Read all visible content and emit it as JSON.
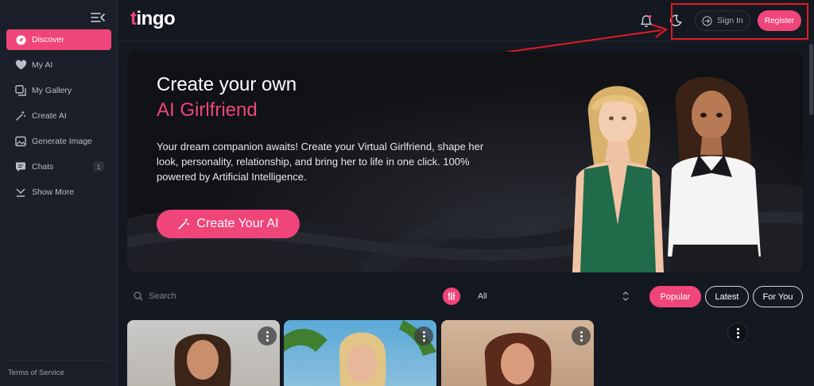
{
  "app": {
    "logo_text": "ingo",
    "logo_initial": "t"
  },
  "sidebar": {
    "items": [
      {
        "label": "Discover",
        "icon": "compass-icon",
        "active": true
      },
      {
        "label": "My AI",
        "icon": "heart-icon"
      },
      {
        "label": "My Gallery",
        "icon": "gallery-icon"
      },
      {
        "label": "Create AI",
        "icon": "magic-wand-icon"
      },
      {
        "label": "Generate Image",
        "icon": "image-icon"
      },
      {
        "label": "Chats",
        "icon": "chat-icon",
        "badge": "1"
      },
      {
        "label": "Show More",
        "icon": "chevron-down-icon"
      }
    ],
    "footer_link": "Terms of Service"
  },
  "header": {
    "signin_label": "Sign In",
    "register_label": "Register"
  },
  "hero": {
    "title_line1": "Create your own",
    "title_line2": "AI Girlfriend",
    "description": "Your dream companion awaits! Create your Virtual Girlfriend, shape her look, personality, relationship, and bring her to life in one click. 100% powered by Artificial Intelligence.",
    "cta_label": "Create Your AI"
  },
  "filters": {
    "search_placeholder": "Search",
    "select_value": "All",
    "tabs": [
      {
        "label": "Popular",
        "active": true
      },
      {
        "label": "Latest"
      },
      {
        "label": "For You"
      }
    ]
  },
  "colors": {
    "accent": "#f0457a",
    "annotation": "#e21b24",
    "background": "#141821"
  }
}
